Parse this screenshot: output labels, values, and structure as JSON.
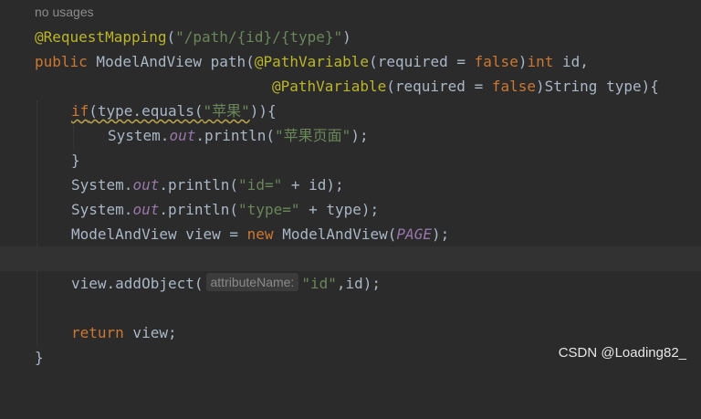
{
  "hint": "no usages",
  "code": {
    "l1": {
      "annotation": "@RequestMapping",
      "open": "(",
      "str": "\"/path/{id}/{type}\"",
      "close": ")"
    },
    "l2": {
      "kw_public": "public",
      "s1": " ModelAndView ",
      "method": "path",
      "s2": "(",
      "ann": "@PathVariable",
      "s3": "(required = ",
      "kw_false": "false",
      "s4": ")",
      "kw_int": "int",
      "s5": " id,"
    },
    "l3": {
      "ann": "@PathVariable",
      "s1": "(required = ",
      "kw_false": "false",
      "s2": ")String type){"
    },
    "l4": {
      "kw_if": "if",
      "s1": "(type.equals(",
      "str": "\"苹果\"",
      "s2": ")){"
    },
    "l5": {
      "s1": "System.",
      "field": "out",
      "s2": ".println(",
      "str": "\"苹果页面\"",
      "s3": ");"
    },
    "l6": {
      "s1": "}"
    },
    "l7": {
      "s1": "System.",
      "field": "out",
      "s2": ".println(",
      "str": "\"id=\"",
      "s3": " + id);"
    },
    "l8": {
      "s1": "System.",
      "field": "out",
      "s2": ".println(",
      "str": "\"type=\"",
      "s3": " + type);"
    },
    "l9": {
      "s1": "ModelAndView view = ",
      "kw_new": "new",
      "s2": " ModelAndView(",
      "const": "PAGE",
      "s3": ");"
    },
    "l11": {
      "s1": "view.addObject(",
      "param_hint": "attributeName:",
      "str": "\"id\"",
      "s2": ",id);"
    },
    "l13": {
      "kw_return": "return",
      "s1": " view;"
    },
    "l14": {
      "s1": "}"
    }
  },
  "watermark": "CSDN @Loading82_",
  "colors": {
    "background": "#2b2b2b",
    "current_line": "#323232",
    "keyword": "#cc7832",
    "annotation": "#bbb529",
    "string": "#6a8759",
    "field": "#9876aa",
    "text": "#a9b7c6"
  }
}
